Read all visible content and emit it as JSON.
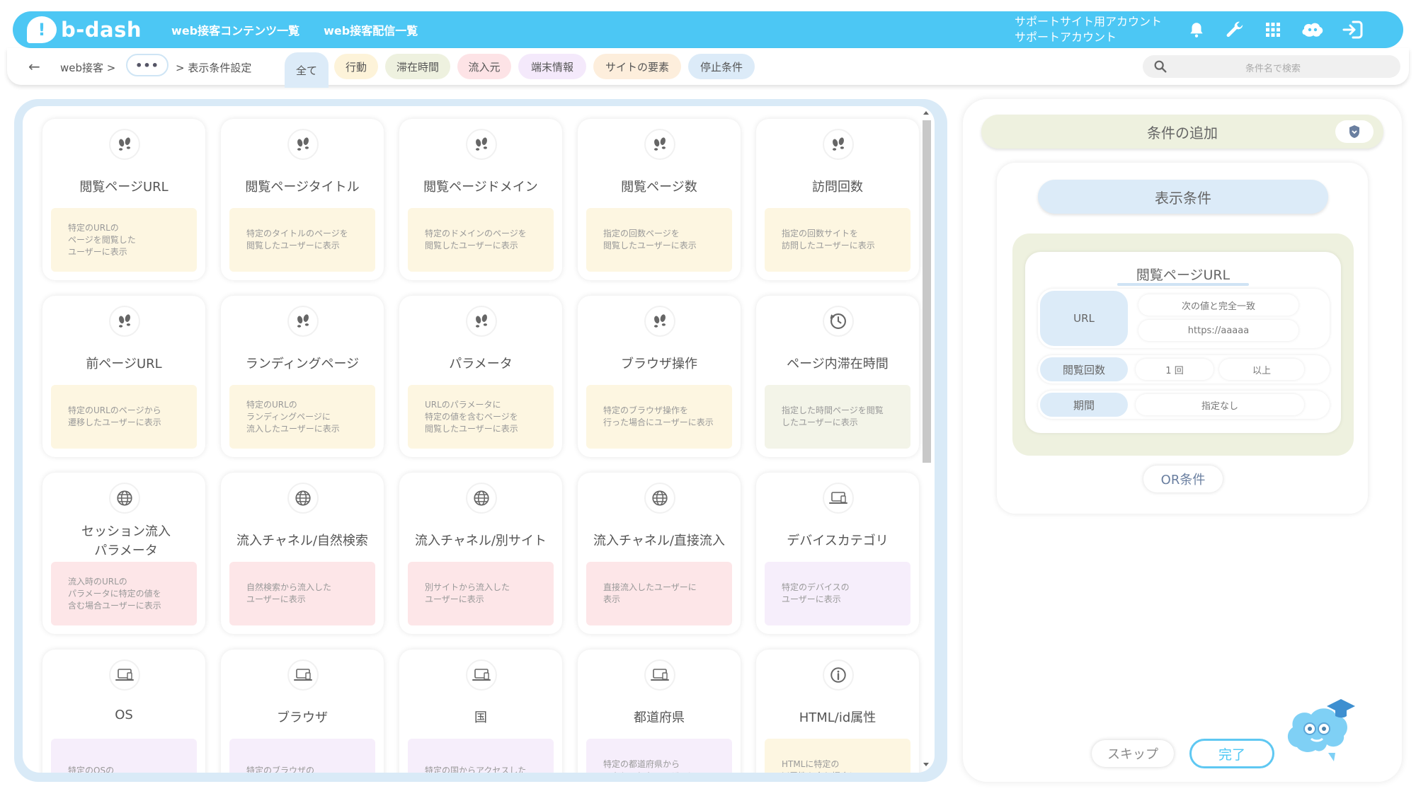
{
  "header": {
    "logo_text": "b-dash",
    "nav": [
      "web接客コンテンツ一覧",
      "web接客配信一覧"
    ],
    "account_line1": "サポートサイト用アカウント",
    "account_line2": "サポートアカウント",
    "icons": [
      "bell-icon",
      "wrench-icon",
      "grid-icon",
      "mascot-icon",
      "logout-icon"
    ]
  },
  "subheader": {
    "back": "←",
    "crumb1": "web接客 >",
    "crumb_more": "•••",
    "crumb2": "> 表示条件設定",
    "tabs": [
      {
        "label": "全て",
        "color": "#dcebf8"
      },
      {
        "label": "行動",
        "color": "#fdf3d9"
      },
      {
        "label": "滞在時間",
        "color": "#eef1df"
      },
      {
        "label": "流入元",
        "color": "#fde3e6"
      },
      {
        "label": "端末情報",
        "color": "#f4e9fb"
      },
      {
        "label": "サイトの要素",
        "color": "#fdeedc"
      },
      {
        "label": "停止条件",
        "color": "#dcebf8"
      }
    ],
    "search_placeholder": "条件名で検索"
  },
  "cards": [
    {
      "title": "閲覧ページURL",
      "desc": "特定のURLの\nページを閲覧した\nユーザーに表示",
      "icon": "footprints-icon",
      "color": "#fdf6e1"
    },
    {
      "title": "閲覧ページタイトル",
      "desc": "特定のタイトルのページを\n閲覧したユーザーに表示",
      "icon": "footprints-icon",
      "color": "#fdf6e1"
    },
    {
      "title": "閲覧ページドメイン",
      "desc": "特定のドメインのページを\n閲覧したユーザーに表示",
      "icon": "footprints-icon",
      "color": "#fdf6e1"
    },
    {
      "title": "閲覧ページ数",
      "desc": "指定の回数ページを\n閲覧したユーザーに表示",
      "icon": "footprints-icon",
      "color": "#fdf6e1"
    },
    {
      "title": "訪問回数",
      "desc": "指定の回数サイトを\n訪問したユーザーに表示",
      "icon": "footprints-icon",
      "color": "#fdf6e1"
    },
    {
      "title": "前ページURL",
      "desc": "特定のURLのページから\n遷移したユーザーに表示",
      "icon": "footprints-icon",
      "color": "#fdf6e1"
    },
    {
      "title": "ランディングページ",
      "desc": "特定のURLの\nランディングページに\n流入したユーザーに表示",
      "icon": "footprints-icon",
      "color": "#fdf6e1"
    },
    {
      "title": "パラメータ",
      "desc": "URLのパラメータに\n特定の値を含むページを\n閲覧したユーザーに表示",
      "icon": "footprints-icon",
      "color": "#fdf6e1"
    },
    {
      "title": "ブラウザ操作",
      "desc": "特定のブラウザ操作を\n行った場合にユーザーに表示",
      "icon": "footprints-icon",
      "color": "#fdf6e1"
    },
    {
      "title": "ページ内滞在時間",
      "desc": "指定した時間ページを閲覧\nしたユーザーに表示",
      "icon": "clock-icon",
      "color": "#f3f4e8"
    },
    {
      "title": "セッション流入\nパラメータ",
      "desc": "流入時のURLの\nパラメータに特定の値を\n含む場合ユーザーに表示",
      "icon": "globe-icon",
      "color": "#fde6e8"
    },
    {
      "title": "流入チャネル/自然検索",
      "desc": "自然検索から流入した\nユーザーに表示",
      "icon": "globe-icon",
      "color": "#fde6e8"
    },
    {
      "title": "流入チャネル/別サイト",
      "desc": "別サイトから流入した\nユーザーに表示",
      "icon": "globe-icon",
      "color": "#fde6e8"
    },
    {
      "title": "流入チャネル/直接流入",
      "desc": "直接流入したユーザーに\n表示",
      "icon": "globe-icon",
      "color": "#fde6e8"
    },
    {
      "title": "デバイスカテゴリ",
      "desc": "特定のデバイスの\nユーザーに表示",
      "icon": "laptop-icon",
      "color": "#f6eefb"
    },
    {
      "title": "OS",
      "desc": "特定のOSの",
      "icon": "laptop-icon",
      "color": "#f6eefb"
    },
    {
      "title": "ブラウザ",
      "desc": "特定のブラウザの",
      "icon": "laptop-icon",
      "color": "#f6eefb"
    },
    {
      "title": "国",
      "desc": "特定の国からアクセスした",
      "icon": "laptop-icon",
      "color": "#f6eefb"
    },
    {
      "title": "都道府県",
      "desc": "特定の都道府県から\nアクセスしたユーザーに",
      "icon": "laptop-icon",
      "color": "#f6eefb"
    },
    {
      "title": "HTML/id属性",
      "desc": "HTMLに特定の\nid属性を含む場合に",
      "icon": "info-icon",
      "color": "#fdf6e1"
    }
  ],
  "right": {
    "add_label": "条件の追加",
    "section_title": "表示条件",
    "condition_title": "閲覧ページURL",
    "url_label": "URL",
    "url_match": "次の値と完全一致",
    "url_value": "https://aaaaa",
    "views_label": "閲覧回数",
    "views_value": "1 回",
    "views_op": "以上",
    "period_label": "期間",
    "period_value": "指定なし",
    "or_label": "OR条件",
    "skip_label": "スキップ",
    "done_label": "完了"
  }
}
